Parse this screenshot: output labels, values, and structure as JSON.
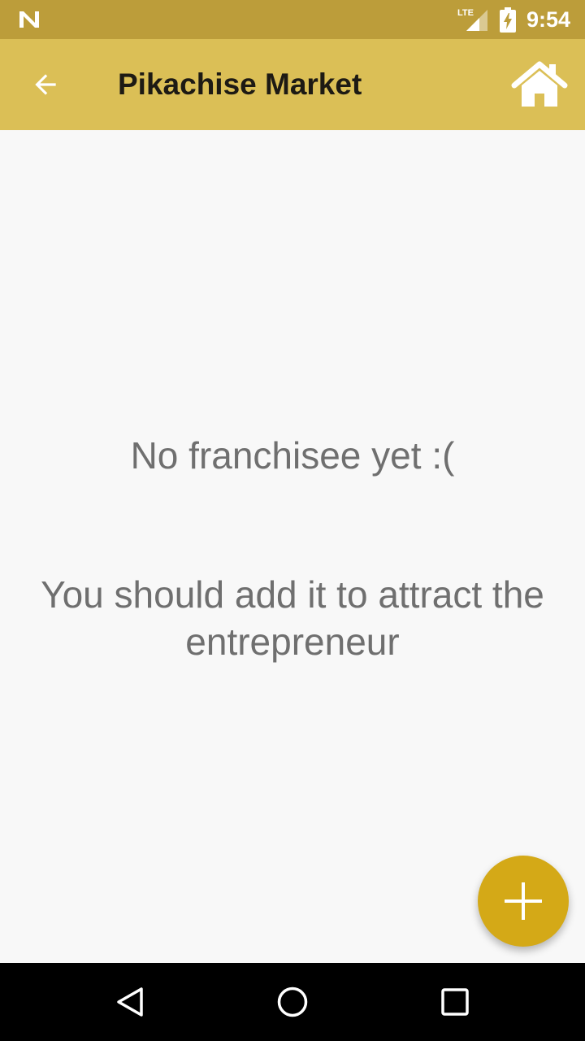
{
  "status_bar": {
    "time": "9:54",
    "network_label": "LTE",
    "icons": [
      "n-logo-icon",
      "lte-signal-icon",
      "battery-charging-icon"
    ]
  },
  "toolbar": {
    "title": "Pikachise Market",
    "back_icon": "arrow-back-icon",
    "home_icon": "home-icon"
  },
  "content": {
    "empty_title": "No franchisee yet :(",
    "empty_message": "You should add it to attract the entrepreneur"
  },
  "fab": {
    "icon": "plus-icon"
  },
  "nav_bar": {
    "icons": [
      "back-triangle-icon",
      "home-circle-icon",
      "recents-square-icon"
    ]
  },
  "colors": {
    "status_bar": "#bc9d3a",
    "toolbar": "#dbbf56",
    "fab": "#d4a917",
    "background": "#f8f8f8",
    "text": "#6f6f6f"
  }
}
